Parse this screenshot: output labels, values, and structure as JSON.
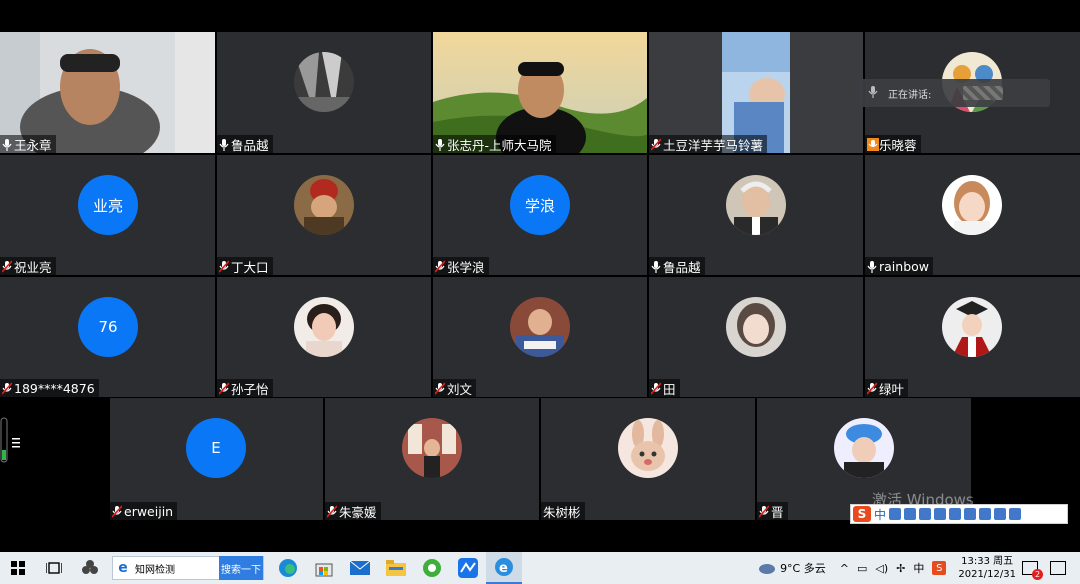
{
  "speaking_popup": {
    "label": "正在讲话:"
  },
  "participants": [
    {
      "name": "王永章",
      "mic": "on",
      "kind": "video"
    },
    {
      "name": "鲁品越",
      "mic": "on",
      "kind": "photo"
    },
    {
      "name": "张志丹-上师大马院",
      "mic": "on",
      "kind": "video"
    },
    {
      "name": "土豆洋芋芋马铃薯",
      "mic": "muted",
      "kind": "video"
    },
    {
      "name": "乐晓蓉",
      "mic": "muted",
      "kind": "photo"
    },
    {
      "name": "祝业亮",
      "mic": "muted",
      "kind": "initials",
      "initials": "业亮"
    },
    {
      "name": "丁大口",
      "mic": "muted",
      "kind": "photo"
    },
    {
      "name": "张学浪",
      "mic": "muted",
      "kind": "initials",
      "initials": "学浪"
    },
    {
      "name": "鲁品越",
      "mic": "on",
      "kind": "photo"
    },
    {
      "name": "rainbow",
      "mic": "on",
      "kind": "photo"
    },
    {
      "name": "189****4876",
      "mic": "muted",
      "kind": "initials",
      "initials": "76"
    },
    {
      "name": "孙子怡",
      "mic": "muted",
      "kind": "photo"
    },
    {
      "name": "刘文",
      "mic": "muted",
      "kind": "photo"
    },
    {
      "name": "田",
      "mic": "muted",
      "kind": "photo"
    },
    {
      "name": "绿叶",
      "mic": "muted",
      "kind": "photo"
    },
    {
      "name": "erweijin",
      "mic": "muted",
      "kind": "initials",
      "initials": "E"
    },
    {
      "name": "朱豪媛",
      "mic": "muted",
      "kind": "photo"
    },
    {
      "name": "朱树彬",
      "mic": "none",
      "kind": "photo"
    },
    {
      "name": "晋",
      "mic": "muted",
      "kind": "photo"
    }
  ],
  "watermark": "激活 Windows",
  "ime": {
    "logo": "S",
    "mode": "中"
  },
  "taskbar": {
    "search_placeholder": "知网检测",
    "search_button": "搜索一下",
    "weather": "9°C 多云",
    "ime_indicator": "中",
    "time": "13:33 周五",
    "date": "2021/12/31",
    "notification_count": "2"
  },
  "colors": {
    "tile_bg": "#2b2d30",
    "avatar_blue": "#0a78f6",
    "mute_red": "#e02020",
    "taskbar_bg": "#e9eef2"
  }
}
